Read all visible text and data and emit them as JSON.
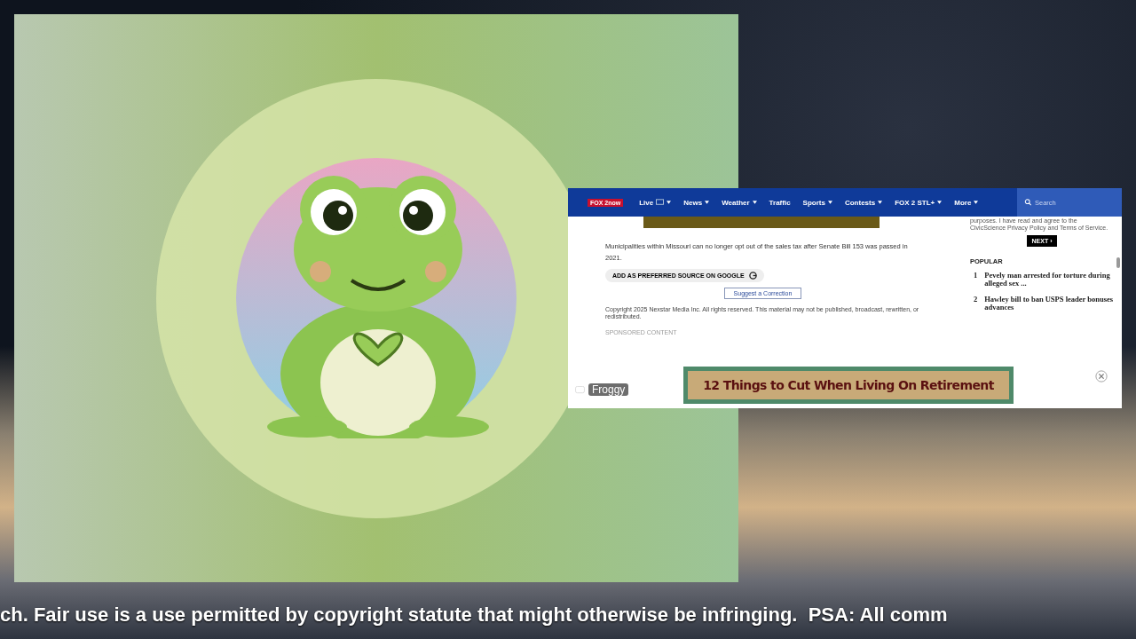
{
  "video": {
    "channel": "Froggy"
  },
  "article_page": {
    "logo": {
      "part1": "FOX 2",
      "part2": "now"
    },
    "nav": [
      {
        "label": "Live",
        "dropdown": true,
        "tv": true
      },
      {
        "label": "News",
        "dropdown": true,
        "tv": false
      },
      {
        "label": "Weather",
        "dropdown": true,
        "tv": false
      },
      {
        "label": "Traffic",
        "dropdown": false,
        "tv": false
      },
      {
        "label": "Sports",
        "dropdown": true,
        "tv": false
      },
      {
        "label": "Contests",
        "dropdown": true,
        "tv": false
      },
      {
        "label": "FOX 2 STL+",
        "dropdown": true,
        "tv": false
      },
      {
        "label": "More",
        "dropdown": true,
        "tv": false
      }
    ],
    "search": {
      "placeholder": "Search"
    },
    "body_text": "Municipalities within Missouri can no longer opt out of the sales tax after Senate Bill 153 was passed in 2021.",
    "preferred_source_button": "ADD AS PREFERRED SOURCE ON GOOGLE",
    "correction_button": "Suggest a Correction",
    "copyright": "Copyright 2025 Nexstar Media Inc. All rights reserved. This material may not be published, broadcast, rewritten, or redistributed.",
    "sponsored_label": "SPONSORED CONTENT",
    "poll_text": "purposes. I have read and agree to the CivicScience Privacy Policy and Terms of Service.",
    "next_button": "NEXT ›",
    "popular": {
      "heading": "POPULAR",
      "items": [
        {
          "number": "1",
          "title": "Pevely man arrested for torture during alleged sex ..."
        },
        {
          "number": "2",
          "title": "Hawley bill to ban USPS leader bonuses advances"
        }
      ]
    },
    "ad": {
      "text": "12 Things to Cut When Living On Retirement"
    }
  },
  "ticker": "ch. Fair use is a use permitted by copyright statute that might otherwise be infringing.  PSA: All comm"
}
